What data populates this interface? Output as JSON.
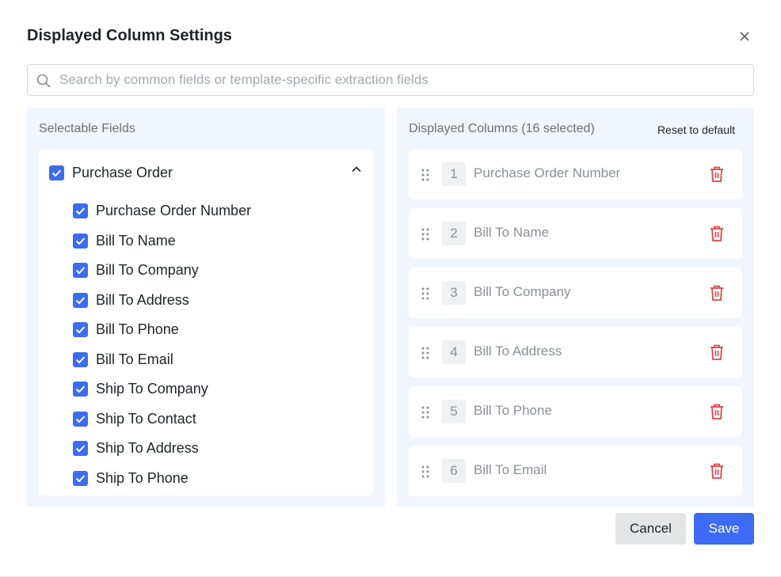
{
  "dialog": {
    "title": "Displayed Column Settings"
  },
  "search": {
    "placeholder": "Search by common fields or template-specific extraction fields",
    "value": ""
  },
  "left_panel": {
    "title": "Selectable Fields",
    "group": {
      "label": "Purchase Order",
      "checked": true,
      "expanded": true
    },
    "fields": [
      {
        "label": "Purchase Order Number",
        "checked": true
      },
      {
        "label": "Bill To Name",
        "checked": true
      },
      {
        "label": "Bill To Company",
        "checked": true
      },
      {
        "label": "Bill To Address",
        "checked": true
      },
      {
        "label": "Bill To Phone",
        "checked": true
      },
      {
        "label": "Bill To Email",
        "checked": true
      },
      {
        "label": "Ship To Company",
        "checked": true
      },
      {
        "label": "Ship To Contact",
        "checked": true
      },
      {
        "label": "Ship To Address",
        "checked": true
      },
      {
        "label": "Ship To Phone",
        "checked": true
      },
      {
        "label": "",
        "checked": true
      }
    ]
  },
  "right_panel": {
    "title": "Displayed Columns (16 selected)",
    "reset_label": "Reset to default",
    "columns": [
      {
        "index": "1",
        "label": "Purchase Order Number"
      },
      {
        "index": "2",
        "label": "Bill To Name"
      },
      {
        "index": "3",
        "label": "Bill To Company"
      },
      {
        "index": "4",
        "label": "Bill To Address"
      },
      {
        "index": "5",
        "label": "Bill To Phone"
      },
      {
        "index": "6",
        "label": "Bill To Email"
      }
    ]
  },
  "footer": {
    "cancel_label": "Cancel",
    "save_label": "Save"
  },
  "colors": {
    "accent": "#3c6cf3",
    "danger": "#e54545",
    "panel_bg": "#f1f5fd"
  }
}
